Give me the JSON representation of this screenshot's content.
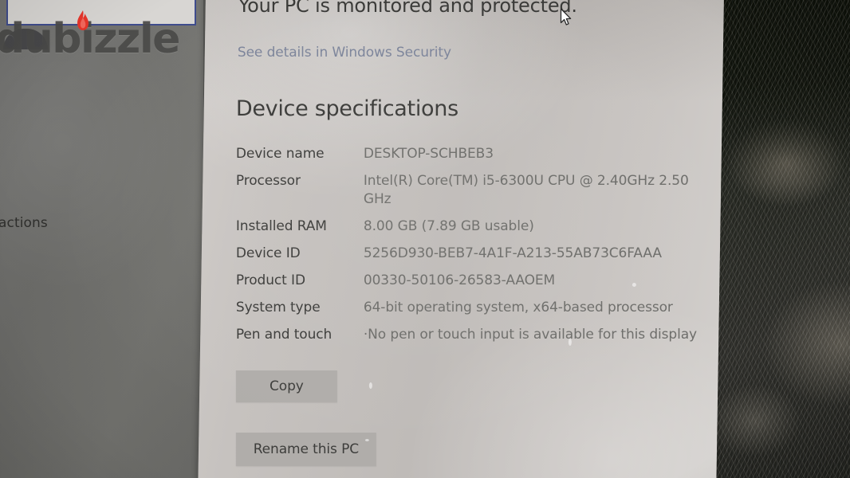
{
  "overlay": {
    "watermark_text": "dubizzle",
    "flame_icon": "flame-icon",
    "flame_color": "#e8352a"
  },
  "search": {
    "icon": "search-icon",
    "value": "",
    "placeholder": ""
  },
  "left_panel": {
    "nav_fragment_label": "actions"
  },
  "settings": {
    "protection_status": "Your PC is monitored and protected.",
    "security_link": "See details in Windows Security",
    "section_title": "Device specifications",
    "specs": [
      {
        "label": "Device name",
        "value": "DESKTOP-SCHBEB3"
      },
      {
        "label": "Processor",
        "value": "Intel(R) Core(TM) i5-6300U CPU @ 2.40GHz   2.50 GHz"
      },
      {
        "label": "Installed RAM",
        "value": "8.00 GB (7.89 GB usable)"
      },
      {
        "label": "Device ID",
        "value": "5256D930-BEB7-4A1F-A213-55AB73C6FAAA"
      },
      {
        "label": "Product ID",
        "value": "00330-50106-26583-AAOEM"
      },
      {
        "label": "System type",
        "value": "64-bit operating system, x64-based processor"
      },
      {
        "label": "Pen and touch",
        "value": "·No pen or touch input is available for this display"
      }
    ],
    "buttons": {
      "copy": "Copy",
      "rename": "Rename this PC"
    }
  },
  "cursor": {
    "icon": "arrow-pointer-icon"
  },
  "colors": {
    "panel_background": "#c6c2bf",
    "left_panel": "#6a6a67",
    "label_text": "#3c3c3a",
    "value_text": "#6d6d6a",
    "link": "#7c849a",
    "button": "#b0adaa",
    "search_border": "#3f4c8c"
  }
}
